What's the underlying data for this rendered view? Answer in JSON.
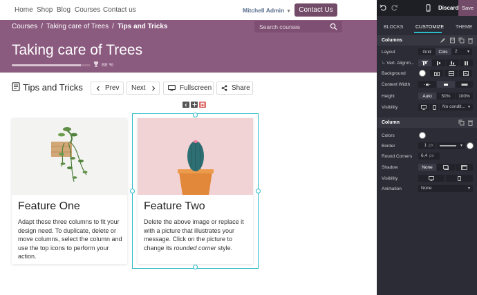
{
  "nav": {
    "links": [
      "Home",
      "Shop",
      "Blog",
      "Courses",
      "Contact us"
    ],
    "user": "Mitchell Admin",
    "contact_button": "Contact Us"
  },
  "breadcrumb": {
    "items": [
      "Courses",
      "Taking care of Trees"
    ],
    "current": "Tips and Tricks",
    "separator": "/",
    "search_placeholder": "Search courses"
  },
  "course": {
    "title": "Taking care of Trees",
    "progress": 0.88,
    "progress_label": "88 %"
  },
  "lesson": {
    "title": "Tips and Tricks",
    "prev": "Prev",
    "next": "Next",
    "fullscreen": "Fullscreen",
    "share": "Share"
  },
  "cards": [
    {
      "title": "Feature One",
      "text": "Adapt these three columns to fit your design need. To duplicate, delete or move columns, select the column and use the top icons to perform your action."
    },
    {
      "title": "Feature Two",
      "text_before": "Delete the above image or replace it with a picture that illustrates your message. Click on the picture to change its ",
      "text_emphasis": "rounded corner",
      "text_after": " style."
    }
  ],
  "editor": {
    "discard": "Discard",
    "save": "Save",
    "tabs": [
      "BLOCKS",
      "CUSTOMIZE",
      "THEME"
    ],
    "active_tab": "CUSTOMIZE",
    "columns_section": {
      "title": "Columns",
      "layout_label": "Layout",
      "layout_options": [
        "Grid",
        "Cols"
      ],
      "layout_selected": "Cols",
      "cols_count": "2",
      "vert_align_label": "Vert. Alignm...",
      "background_label": "Background",
      "content_width_label": "Content Width",
      "height_label": "Height",
      "height_options": [
        "Auto",
        "50%",
        "100%"
      ],
      "height_selected": "Auto",
      "visibility_label": "Visibility",
      "visibility_value": "No condit..."
    },
    "column_section": {
      "title": "Column",
      "colors_label": "Colors",
      "border_label": "Border",
      "border_width": "1",
      "border_unit": "px",
      "round_corners_label": "Round Corners",
      "round_corners_value": "6,4",
      "round_corners_unit": "px",
      "shadow_label": "Shadow",
      "shadow_options": [
        "None"
      ],
      "visibility_label": "Visibility",
      "animation_label": "Animation",
      "animation_value": "None"
    }
  },
  "colors": {
    "brand": "#714b67",
    "hero": "#8b5a7f",
    "selection": "#2cb9c9",
    "panel": "#2b2c35"
  }
}
